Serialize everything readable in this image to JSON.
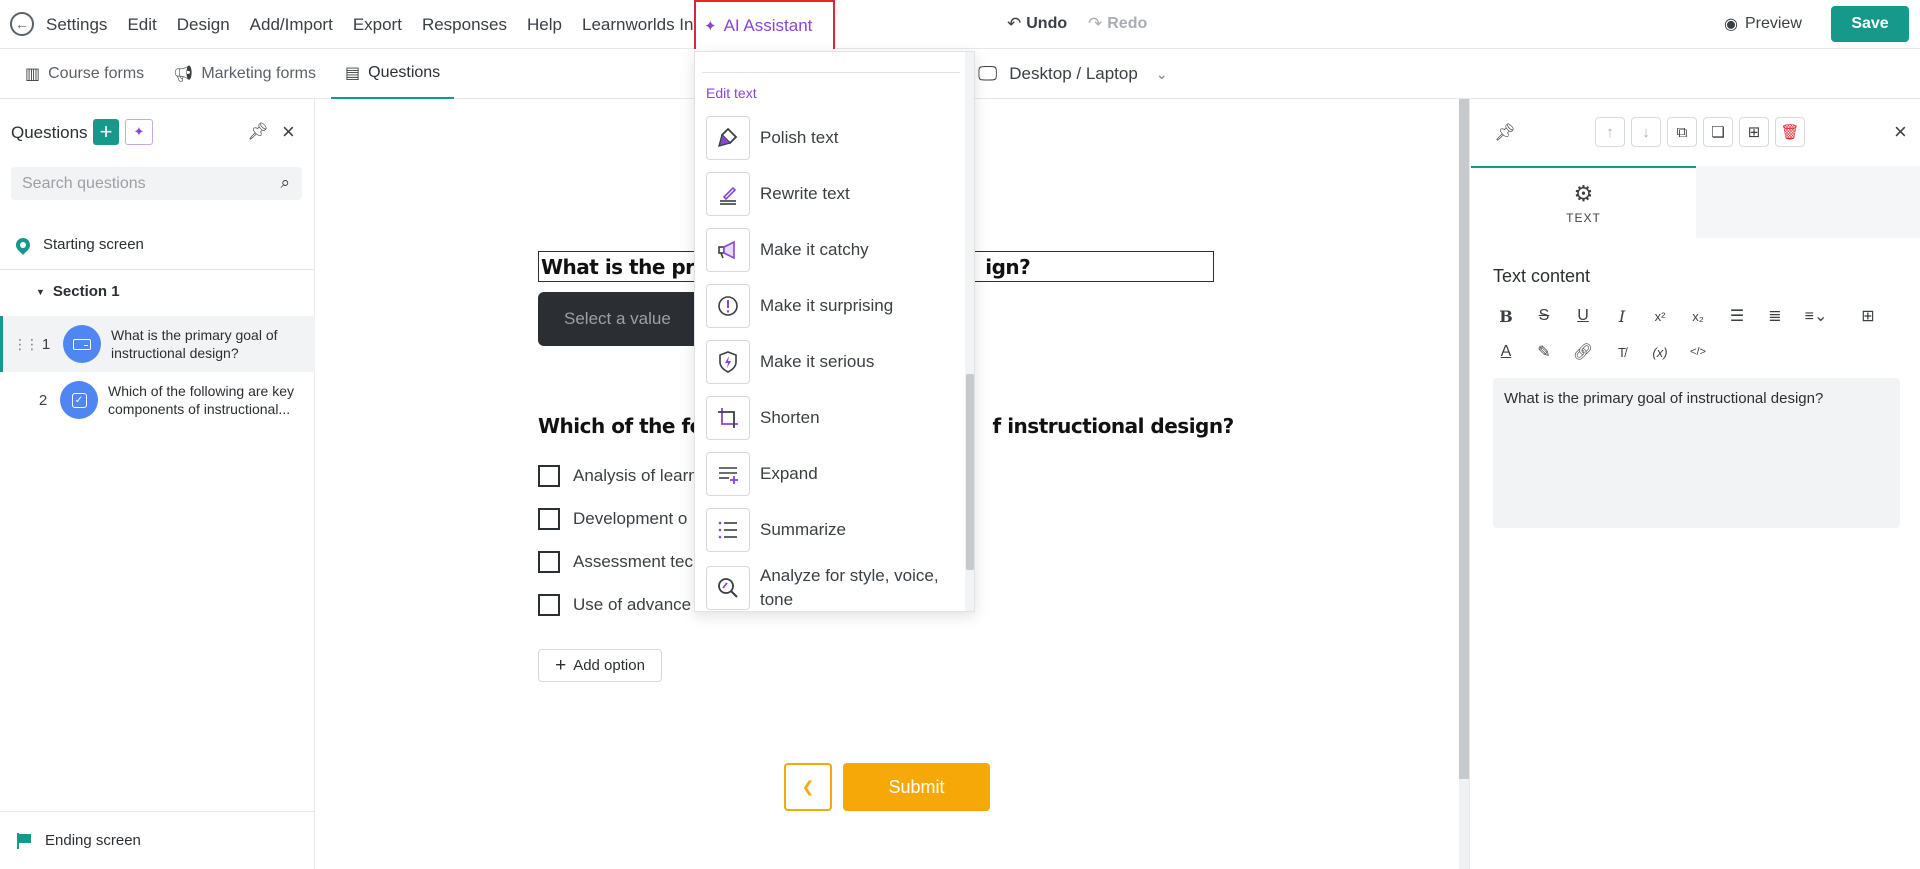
{
  "menu": {
    "items": [
      "Settings",
      "Edit",
      "Design",
      "Add/Import",
      "Export",
      "Responses",
      "Help",
      "Learnworlds Info"
    ],
    "ai_assistant": "AI Assistant",
    "undo": "Undo",
    "redo": "Redo",
    "preview": "Preview",
    "save": "Save"
  },
  "tabs": {
    "course_forms": "Course forms",
    "marketing_forms": "Marketing forms",
    "questions": "Questions",
    "device": "Desktop / Laptop"
  },
  "left_panel": {
    "title": "Questions",
    "search_placeholder": "Search questions",
    "starting_screen": "Starting screen",
    "section": "Section 1",
    "questions": [
      {
        "num": "1",
        "text": "What is the primary goal of instructional design?"
      },
      {
        "num": "2",
        "text": "Which of the following are key components of instructional..."
      }
    ],
    "ending_screen": "Ending screen"
  },
  "canvas": {
    "q1_title_left": "What is the prim",
    "q1_title_right": "ign?",
    "select_placeholder": "Select a value",
    "q2_title_left": "Which of the foll",
    "q2_title_right": "f instructional design?",
    "options": [
      "Analysis of learn",
      "Development o",
      "Assessment tec",
      "Use of advance"
    ],
    "add_option": "Add option",
    "submit": "Submit"
  },
  "ai_dropdown": {
    "group_label": "Edit text",
    "options": [
      {
        "label": "Polish text",
        "icon": "polish-icon"
      },
      {
        "label": "Rewrite text",
        "icon": "rewrite-icon"
      },
      {
        "label": "Make it catchy",
        "icon": "megaphone-icon"
      },
      {
        "label": "Make it surprising",
        "icon": "exclamation-icon"
      },
      {
        "label": "Make it serious",
        "icon": "shield-icon"
      },
      {
        "label": "Shorten",
        "icon": "crop-icon"
      },
      {
        "label": "Expand",
        "icon": "expand-icon"
      },
      {
        "label": "Summarize",
        "icon": "list-icon"
      },
      {
        "label": "Analyze for style, voice, tone",
        "icon": "analyze-icon"
      }
    ]
  },
  "right_panel": {
    "tab_label": "TEXT",
    "heading": "Text content",
    "content": "What is the primary goal of instructional design?"
  },
  "colors": {
    "accent": "#16998a",
    "ai_purple": "#8a45d6",
    "highlight_red": "#e0262f",
    "submit_orange": "#f7a809",
    "question_icon_blue": "#4f86f2"
  }
}
